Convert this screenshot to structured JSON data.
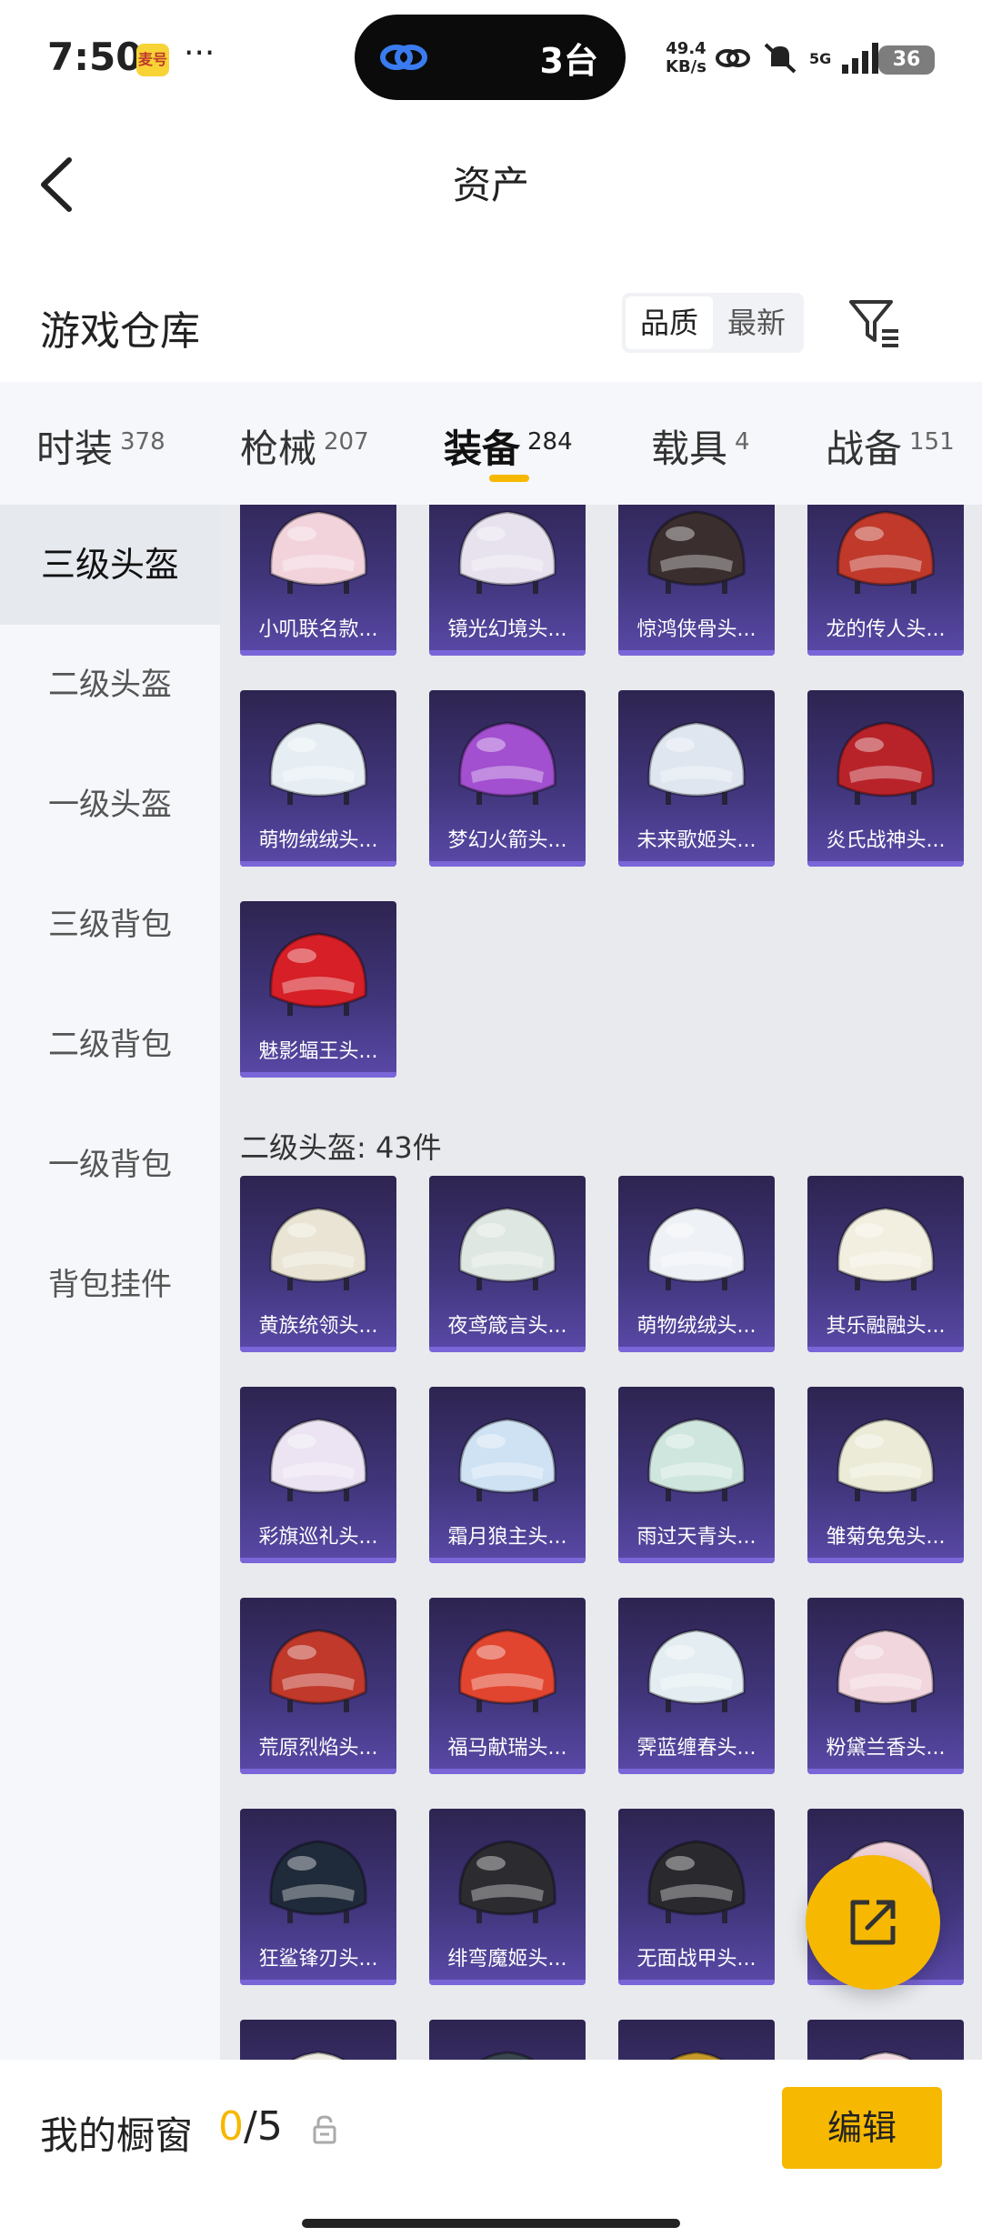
{
  "status_bar": {
    "time": "7:50",
    "app_icon_text": "麦号",
    "dots": "···",
    "pill_text": "3台",
    "net_speed_value": "49.4",
    "net_speed_unit": "KB/s",
    "network": "5G",
    "battery": "36"
  },
  "header": {
    "title": "资产"
  },
  "warehouse": {
    "title": "游戏仓库",
    "sort_options": [
      "品质",
      "最新"
    ],
    "active_sort": "品质"
  },
  "tabs": [
    {
      "label": "时装",
      "count": "378"
    },
    {
      "label": "枪械",
      "count": "207"
    },
    {
      "label": "装备",
      "count": "284",
      "active": true
    },
    {
      "label": "载具",
      "count": "4"
    },
    {
      "label": "战备",
      "count": "151"
    }
  ],
  "sidebar": {
    "items": [
      "三级头盔",
      "二级头盔",
      "一级头盔",
      "三级背包",
      "二级背包",
      "一级背包",
      "背包挂件"
    ],
    "active": "三级头盔"
  },
  "sections": [
    {
      "title": "",
      "items": [
        {
          "name": "小叽联名款...",
          "color": "#f2d3dc"
        },
        {
          "name": "镜光幻境头...",
          "color": "#e7e2ee"
        },
        {
          "name": "惊鸿侠骨头...",
          "color": "#3a2e2e"
        },
        {
          "name": "龙的传人头...",
          "color": "#c0392b"
        },
        {
          "name": "萌物绒绒头...",
          "color": "#e6eef4"
        },
        {
          "name": "梦幻火箭头...",
          "color": "#a24fd0"
        },
        {
          "name": "未来歌姬头...",
          "color": "#dfe6f0"
        },
        {
          "name": "炎氏战神头...",
          "color": "#b8232a"
        },
        {
          "name": "魅影蝠王头...",
          "color": "#d61f26"
        }
      ]
    },
    {
      "title": "二级头盔: 43件",
      "items": [
        {
          "name": "黄族统领头...",
          "color": "#e9e4d4"
        },
        {
          "name": "夜鸢箴言头...",
          "color": "#dfe7e2"
        },
        {
          "name": "萌物绒绒头...",
          "color": "#eef2f6"
        },
        {
          "name": "其乐融融头...",
          "color": "#f2efe0"
        },
        {
          "name": "彩旗巡礼头...",
          "color": "#ece4f2"
        },
        {
          "name": "霜月狼主头...",
          "color": "#cfe2f4"
        },
        {
          "name": "雨过天青头...",
          "color": "#cfe6de"
        },
        {
          "name": "雏菊兔兔头...",
          "color": "#ecebd8"
        },
        {
          "name": "荒原烈焰头...",
          "color": "#c0392b"
        },
        {
          "name": "福马献瑞头...",
          "color": "#e2452f"
        },
        {
          "name": "霁蓝缠春头...",
          "color": "#e4eef2"
        },
        {
          "name": "粉黛兰香头...",
          "color": "#f1d6de"
        },
        {
          "name": "狂鲨锋刃头...",
          "color": "#1f2a3a"
        },
        {
          "name": "绯弯魔姬头...",
          "color": "#2b2b30"
        },
        {
          "name": "无面战甲头...",
          "color": "#2a2a2e"
        },
        {
          "name": "",
          "color": "#f1d3dc"
        },
        {
          "name": "",
          "color": "#f0ece4"
        },
        {
          "name": "",
          "color": "#3a4650"
        },
        {
          "name": "",
          "color": "#c89a2a"
        },
        {
          "name": "",
          "color": "#f2dce2"
        }
      ]
    }
  ],
  "bottom_bar": {
    "label": "我的橱窗",
    "current": "0",
    "total": "/5",
    "edit_label": "编辑"
  }
}
